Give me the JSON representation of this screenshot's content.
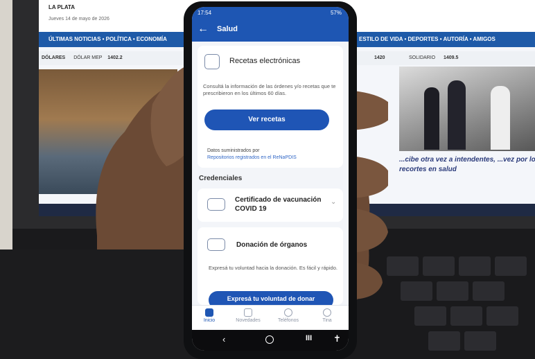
{
  "laptop": {
    "news_city": "LA PLATA",
    "news_date": "Jueves 14 de mayo de 2026",
    "nav_left": "ÚLTIMAS NOTICIAS • POLÍTICA • ECONOMÍA",
    "nav_right": "ESTILO DE VIDA • DEPORTES • AUTORÍA • AMIGOS",
    "ticker_items": [
      "DÓLARES",
      "DÓLAR MEP",
      "1402.2",
      "1420",
      "SOLIDARIO",
      "1409.5"
    ],
    "headline": "...cibe otra vez a intendentes, ...vez por los recortes en salud"
  },
  "phone": {
    "status_time": "17:54",
    "status_battery": "57%",
    "appbar_title": "Salud",
    "recetas": {
      "title": "Recetas electrónicas",
      "description": "Consultá la información de las órdenes y/o recetas que te prescribieron en los últimos 60 días.",
      "button": "Ver recetas",
      "source_label": "Datos suministrados por",
      "source_link": "Repositorios registrados en el ReNaPDIS"
    },
    "section_credenciales": "Credenciales",
    "vacunacion": {
      "title": "Certificado de vacunación COVID 19"
    },
    "donacion": {
      "title": "Donación de órganos",
      "description": "Expresá tu voluntad hacia la donación. Es fácil y rápido.",
      "button": "Expresá tu voluntad de donar"
    },
    "bottom_nav": [
      "Inicio",
      "Novedades",
      "Teléfonos",
      "Tina"
    ],
    "accent": "#1e56b3"
  }
}
